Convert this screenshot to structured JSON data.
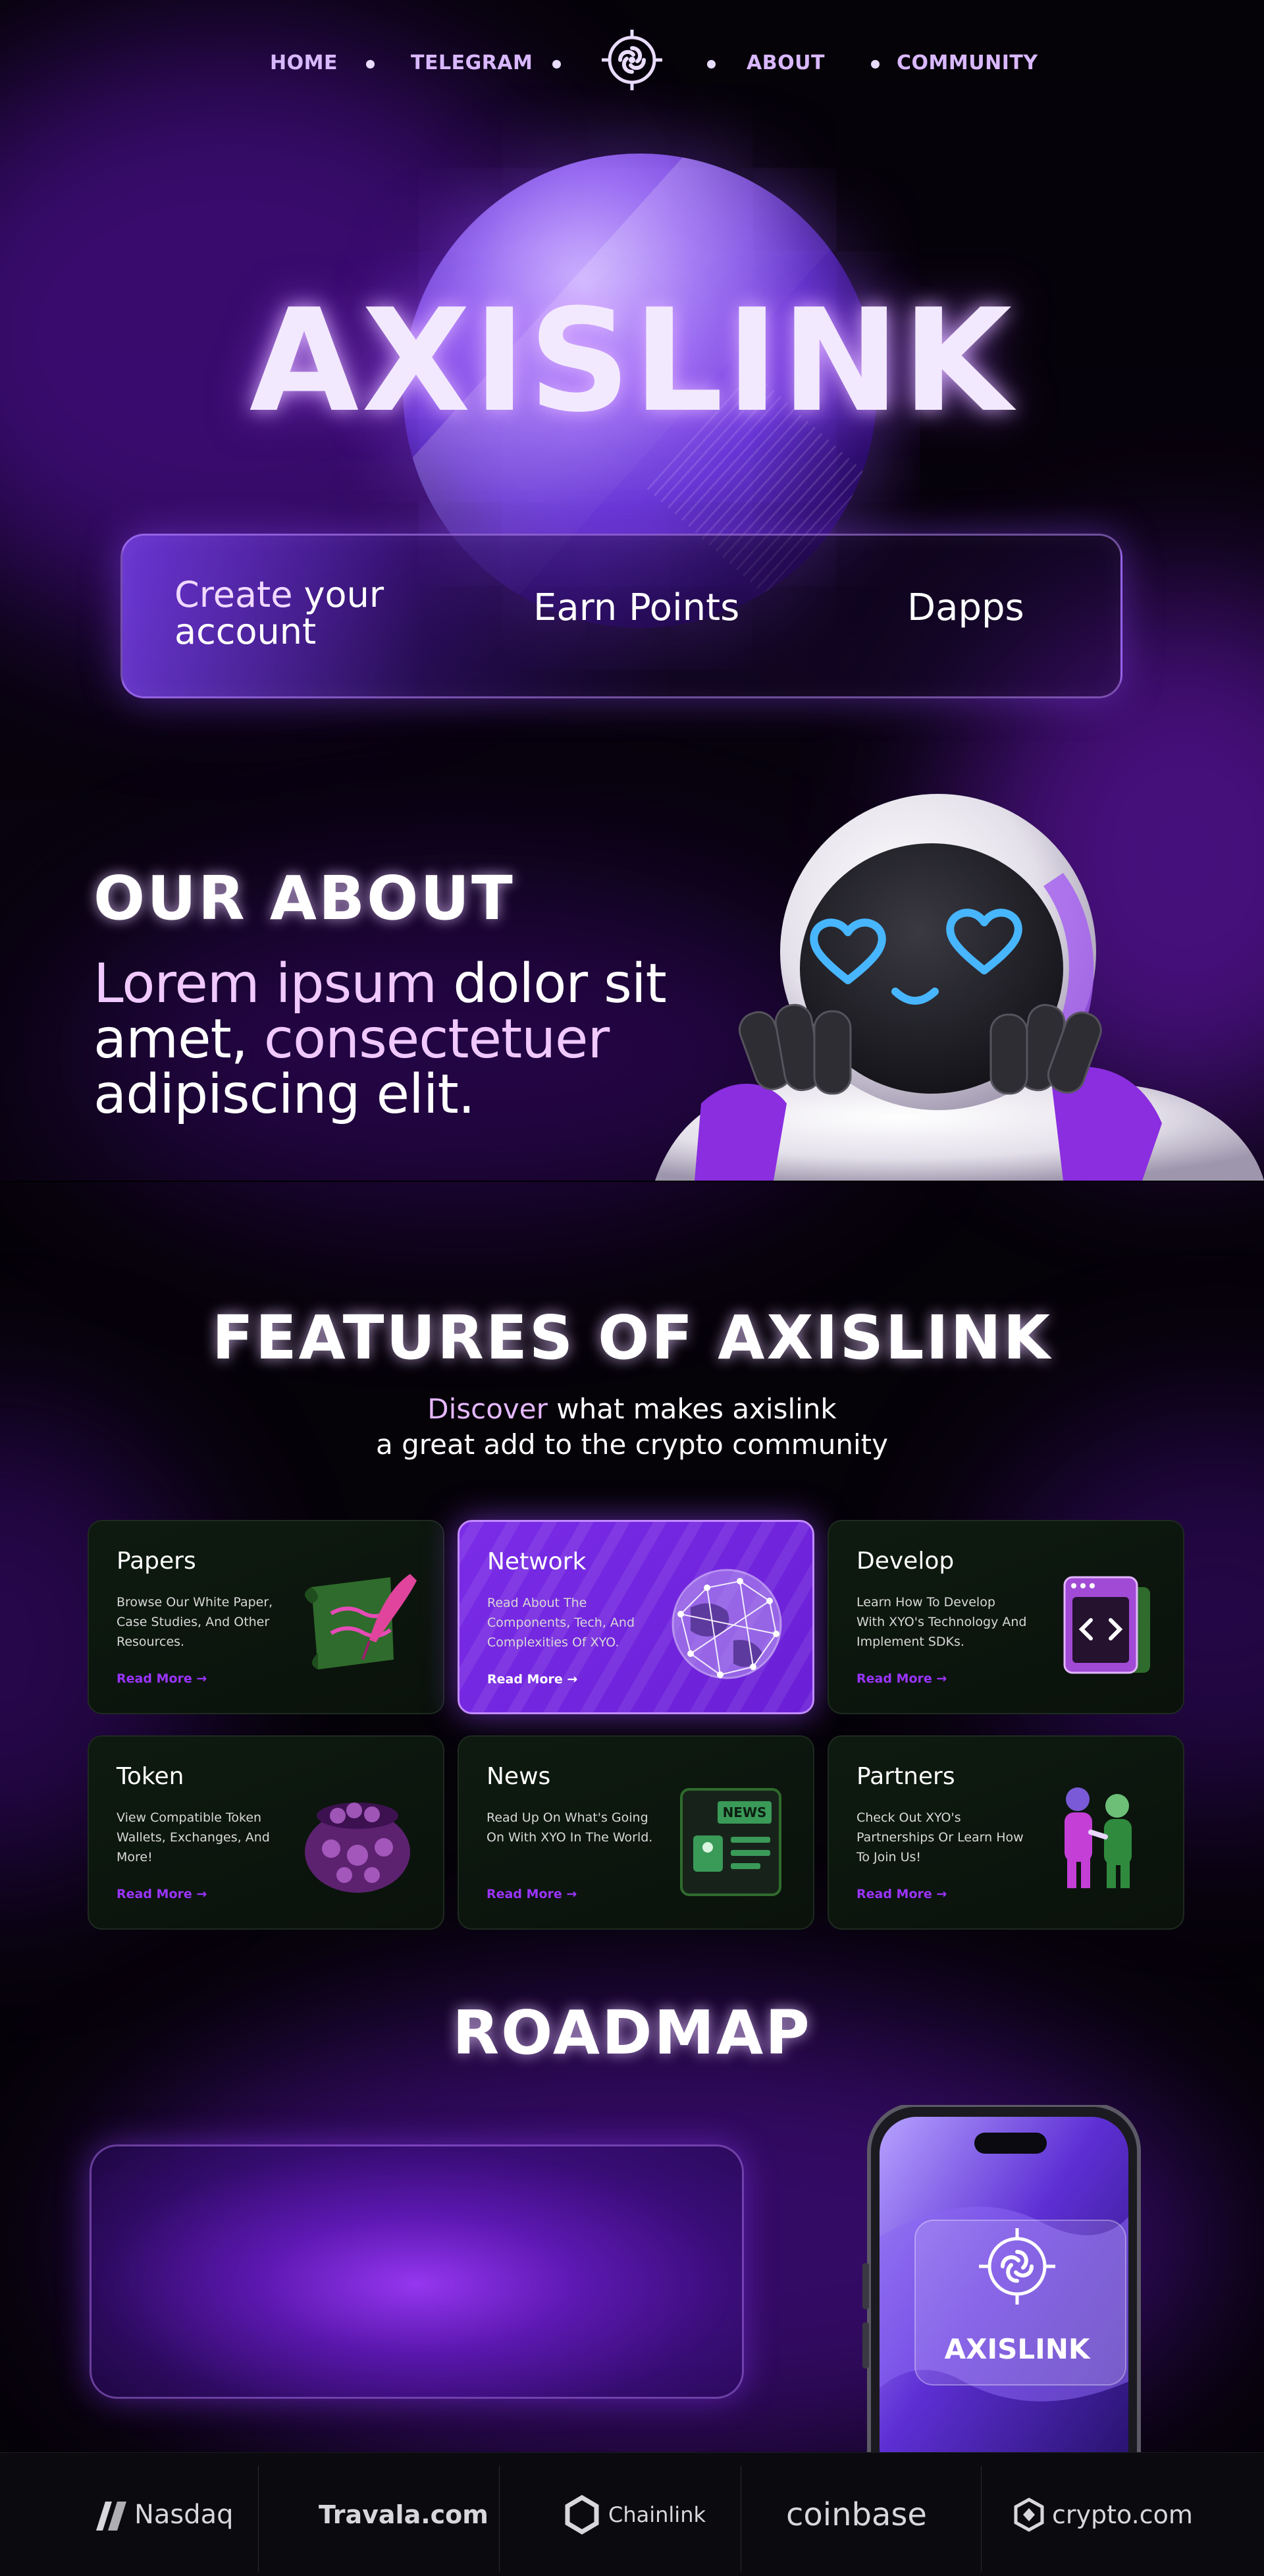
{
  "nav": {
    "home": "HOME",
    "telegram": "TELEGRAM",
    "about": "ABOUT",
    "community": "COMMUNITY"
  },
  "hero": {
    "title": "AXISLINK",
    "cta_create_highlight": "Create",
    "cta_create_rest": " your account",
    "cta_earn": "Earn Points",
    "cta_dapps": "Dapps"
  },
  "about": {
    "title": "OUR ABOUT",
    "text_hl1": "Lorem ipsum",
    "text_1": " dolor sit amet, ",
    "text_hl2": "consectetuer",
    "text_2": " adipiscing elit."
  },
  "features": {
    "title": "FEATURES OF AXISLINK",
    "sub_hl": "Discover",
    "sub_1": " what makes axislink",
    "sub_2": "a great add to the crypto community",
    "cards": [
      {
        "title": "Papers",
        "desc": "Browse Our White Paper, Case Studies, And Other Resources.",
        "more": "Read More →"
      },
      {
        "title": "Network",
        "desc": "Read About The Components, Tech, And Complexities Of XYO.",
        "more": "Read More →"
      },
      {
        "title": "Develop",
        "desc": "Learn How To Develop With XYO's Technology And Implement SDKs.",
        "more": "Read More →"
      },
      {
        "title": "Token",
        "desc": "View Compatible Token Wallets, Exchanges, And More!",
        "more": "Read More →"
      },
      {
        "title": "News",
        "desc": "Read Up On What's Going On With XYO In The World.",
        "more": "Read More →"
      },
      {
        "title": "Partners",
        "desc": "Check Out XYO's Partnerships Or Learn How To Join Us!",
        "more": "Read More →"
      }
    ],
    "news_badge": "NEWS"
  },
  "roadmap": {
    "title": "ROADMAP",
    "phone_label": "AXISLINK"
  },
  "partners": {
    "nasdaq": "Nasdaq",
    "travala": "Travala.com",
    "chainlink": "Chainlink",
    "coinbase": "coinbase",
    "crypto": "crypto.com"
  },
  "colors": {
    "accent": "#9b34ff",
    "background": "#050208",
    "glow": "#7a1bd6"
  }
}
